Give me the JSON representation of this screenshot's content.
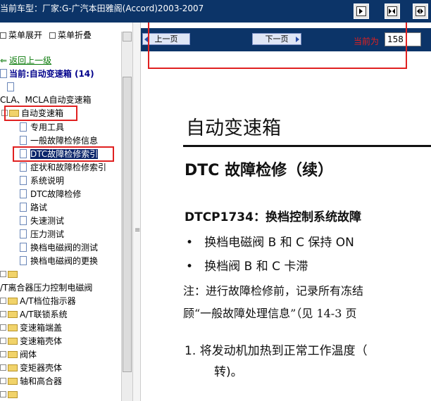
{
  "titlebar": {
    "title": "当前车型：厂家:G-广汽本田雅阁(Accord)2003-2007"
  },
  "toolbar": {
    "expand_label": "菜单展开",
    "collapse_label": "菜单折叠"
  },
  "sidebar": {
    "back_label": "返回上一级",
    "current_label": "当前:自动变速箱 (14)",
    "items": [
      {
        "label": "CLA、MCLA自动变速箱"
      },
      {
        "label": "自动变速箱"
      },
      {
        "label": "专用工具"
      },
      {
        "label": "一般故障检修信息"
      },
      {
        "label": "DTC故障检修索引"
      },
      {
        "label": "症状和故障检修索引"
      },
      {
        "label": "系统说明"
      },
      {
        "label": "DTC故障检修"
      },
      {
        "label": "路试"
      },
      {
        "label": "失速测试"
      },
      {
        "label": "压力测试"
      },
      {
        "label": "换档电磁阀的测试"
      },
      {
        "label": "换档电磁阀的更换"
      },
      {
        "label": "/T离合器压力控制电磁阀"
      },
      {
        "label": "A/T档位指示器"
      },
      {
        "label": "A/T联锁系统"
      },
      {
        "label": "变速箱端盖"
      },
      {
        "label": "变速箱壳体"
      },
      {
        "label": "阀体"
      },
      {
        "label": "变矩器壳体"
      },
      {
        "label": "轴和高合器"
      }
    ]
  },
  "nav": {
    "prev_label": "上一页",
    "next_label": "下一页",
    "current_label": "当前为",
    "page_value": "158"
  },
  "document": {
    "heading": "自动变速箱",
    "subheading": "DTC 故障检修（续）",
    "dtc_line": "DTCP1734：换档控制系统故障",
    "bullets": [
      "换档电磁阀 B 和 C 保持 ON",
      "换档阀 B 和 C 卡滞"
    ],
    "note_line1": "注：进行故障检修前，记录所有冻结",
    "note_line2": "顾“一般故障处理信息”（见 14-3 页",
    "step1_line1": "1.   将发动机加热到正常工作温度（",
    "step1_line2": "转)。"
  }
}
